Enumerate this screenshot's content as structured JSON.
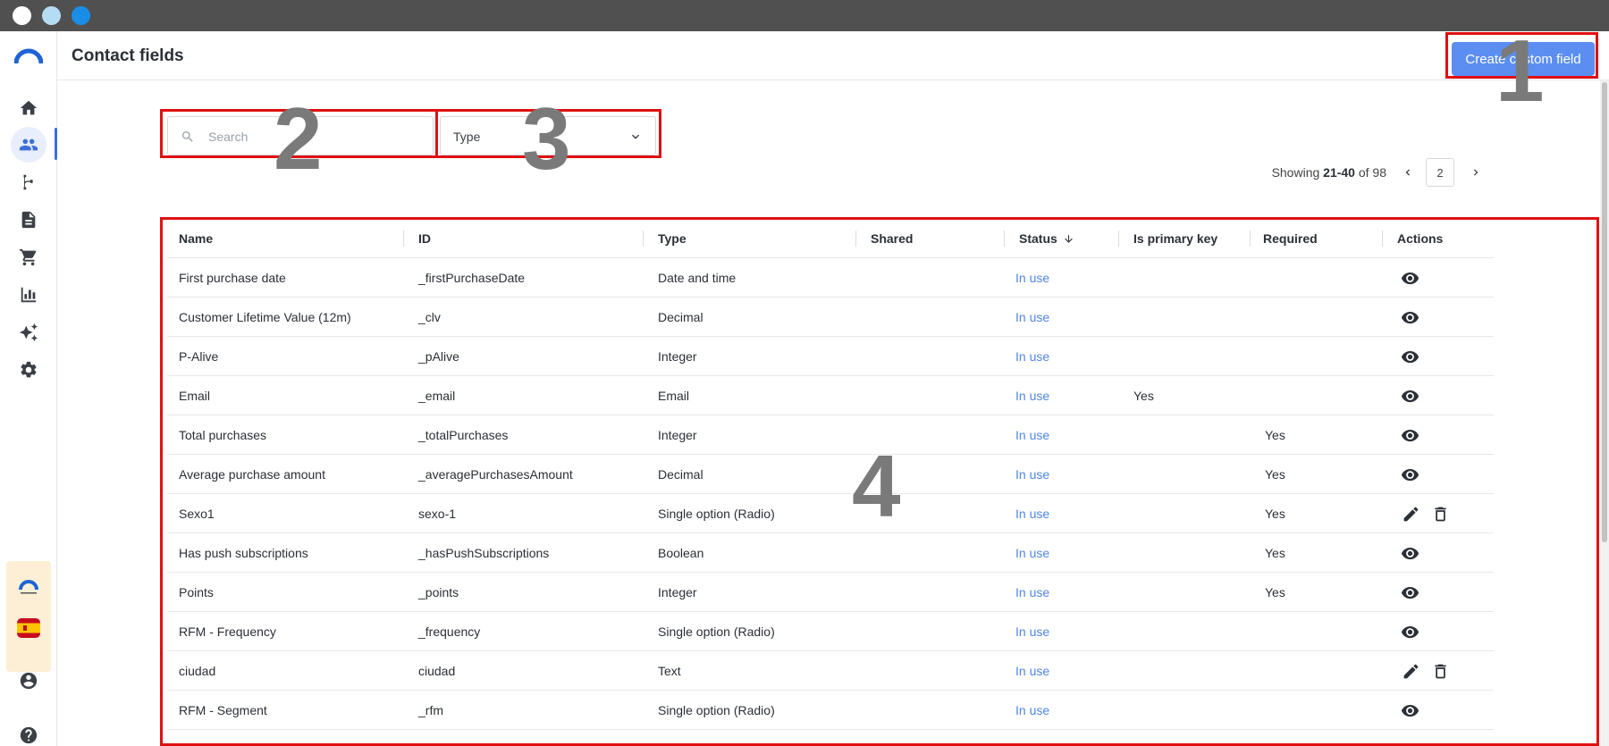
{
  "header": {
    "title": "Contact fields",
    "create_button": "Create custom field"
  },
  "sidebar": {
    "items": [
      "home-icon",
      "contacts-icon",
      "automation-icon",
      "content-icon",
      "store-icon",
      "reports-icon",
      "ai-icon",
      "settings-icon"
    ],
    "bottom": [
      "account-icon",
      "help-icon"
    ],
    "promo_flag": "spain-flag-icon"
  },
  "filters": {
    "search_placeholder": "Search",
    "type_label": "Type"
  },
  "pagination": {
    "prefix": "Showing",
    "range": "21-40",
    "of": "of 98",
    "page": "2"
  },
  "table": {
    "columns": [
      "Name",
      "ID",
      "Type",
      "Shared",
      "Status",
      "Is primary key",
      "Required",
      "Actions"
    ],
    "rows": [
      {
        "name": "First purchase date",
        "id": "_firstPurchaseDate",
        "type": "Date and time",
        "shared": "",
        "status": "In use",
        "pk": "",
        "required": "",
        "actions": "view"
      },
      {
        "name": "Customer Lifetime Value (12m)",
        "id": "_clv",
        "type": "Decimal",
        "shared": "",
        "status": "In use",
        "pk": "",
        "required": "",
        "actions": "view"
      },
      {
        "name": "P-Alive",
        "id": "_pAlive",
        "type": "Integer",
        "shared": "",
        "status": "In use",
        "pk": "",
        "required": "",
        "actions": "view"
      },
      {
        "name": "Email",
        "id": "_email",
        "type": "Email",
        "shared": "",
        "status": "In use",
        "pk": "Yes",
        "required": "",
        "actions": "view"
      },
      {
        "name": "Total purchases",
        "id": "_totalPurchases",
        "type": "Integer",
        "shared": "",
        "status": "In use",
        "pk": "",
        "required": "Yes",
        "actions": "view"
      },
      {
        "name": "Average purchase amount",
        "id": "_averagePurchasesAmount",
        "type": "Decimal",
        "shared": "",
        "status": "In use",
        "pk": "",
        "required": "Yes",
        "actions": "view"
      },
      {
        "name": "Sexo1",
        "id": "sexo-1",
        "type": "Single option (Radio)",
        "shared": "",
        "status": "In use",
        "pk": "",
        "required": "Yes",
        "actions": "edit"
      },
      {
        "name": "Has push subscriptions",
        "id": "_hasPushSubscriptions",
        "type": "Boolean",
        "shared": "",
        "status": "In use",
        "pk": "",
        "required": "Yes",
        "actions": "view"
      },
      {
        "name": "Points",
        "id": "_points",
        "type": "Integer",
        "shared": "",
        "status": "In use",
        "pk": "",
        "required": "Yes",
        "actions": "view"
      },
      {
        "name": "RFM - Frequency",
        "id": "_frequency",
        "type": "Single option (Radio)",
        "shared": "",
        "status": "In use",
        "pk": "",
        "required": "",
        "actions": "view"
      },
      {
        "name": "ciudad",
        "id": "ciudad",
        "type": "Text",
        "shared": "",
        "status": "In use",
        "pk": "",
        "required": "",
        "actions": "edit"
      },
      {
        "name": "RFM - Segment",
        "id": "_rfm",
        "type": "Single option (Radio)",
        "shared": "",
        "status": "In use",
        "pk": "",
        "required": "",
        "actions": "view"
      }
    ]
  },
  "annotations": [
    "1",
    "2",
    "3",
    "4"
  ],
  "colors": {
    "accent": "#5b8ef0",
    "status_link": "#4f86e8",
    "annotation_box": "#e01010",
    "annotation_number": "#7a7a7a"
  }
}
